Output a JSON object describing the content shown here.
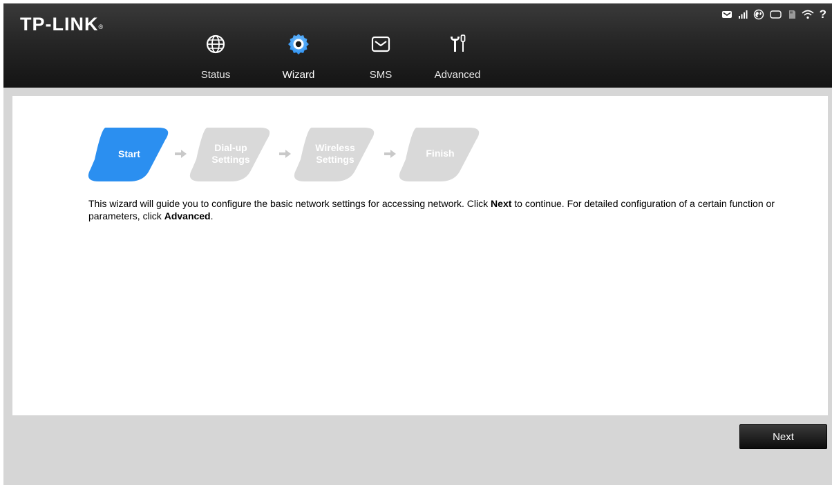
{
  "brand": {
    "logo": "TP-LINK",
    "mark": "®"
  },
  "nav": {
    "items": [
      {
        "label": "Status",
        "icon": "globe-icon"
      },
      {
        "label": "Wizard",
        "icon": "gear-icon",
        "active": true
      },
      {
        "label": "SMS",
        "icon": "envelope-icon"
      },
      {
        "label": "Advanced",
        "icon": "tools-icon"
      }
    ]
  },
  "status_bar": {
    "icons": [
      "message-icon",
      "signal-icon",
      "internet-icon",
      "battery-icon",
      "sd-card-icon",
      "wifi-icon",
      "help-icon"
    ],
    "help_glyph": "?"
  },
  "wizard": {
    "steps": [
      {
        "line1": "Start",
        "line2": "",
        "active": true
      },
      {
        "line1": "Dial-up",
        "line2": "Settings",
        "active": false
      },
      {
        "line1": "Wireless",
        "line2": "Settings",
        "active": false
      },
      {
        "line1": "Finish",
        "line2": "",
        "active": false
      }
    ],
    "description": {
      "part1": "This wizard will guide you to configure the basic network settings for accessing network. Click ",
      "bold1": "Next",
      "part2": " to continue. For detailed configuration of a certain function or parameters, click ",
      "bold2": "Advanced",
      "part3": "."
    }
  },
  "actions": {
    "next_label": "Next"
  },
  "colors": {
    "accent": "#2b8ff0",
    "inactive_step": "#d9d9d9",
    "header_bg": "#1c1c1c",
    "frame_bg": "#d6d6d6"
  }
}
